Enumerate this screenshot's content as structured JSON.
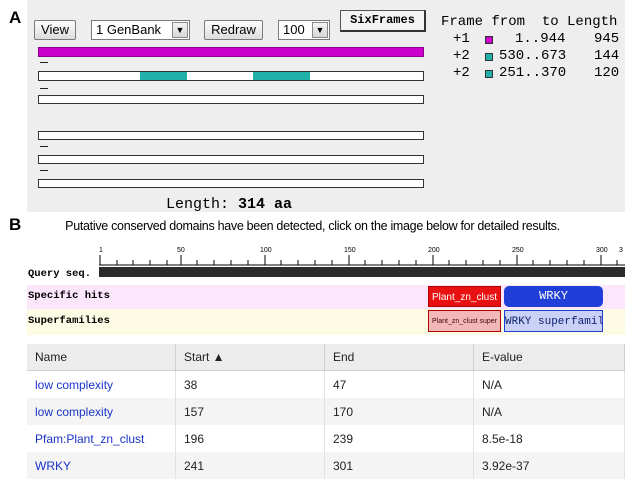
{
  "panel_labels": {
    "a": "A",
    "b": "B"
  },
  "toolbar": {
    "view_label": "View",
    "genbank_select": "1 GenBank",
    "redraw_label": "Redraw",
    "zoom_select": "100",
    "sixframes_label": "SixFrames"
  },
  "frame_table": {
    "header": "Frame from  to Length",
    "rows": [
      {
        "frame": "+1",
        "color": "#cc00cc",
        "range": "1..944",
        "length": "945"
      },
      {
        "frame": "+2",
        "color": "#20b2aa",
        "range": "530..673",
        "length": "144"
      },
      {
        "frame": "+2",
        "color": "#20b2aa",
        "range": "251..370",
        "length": "120"
      }
    ]
  },
  "length_line": {
    "prefix": "Length:",
    "value": "314 aa"
  },
  "cdd": {
    "notice": "Putative conserved domains have been detected, click on the image below for detailed results.",
    "row_labels": {
      "query": "Query seq.",
      "specific": "Specific hits",
      "super": "Superfamilies"
    },
    "ruler_ticks": [
      "1",
      "50",
      "100",
      "150",
      "200",
      "250",
      "300",
      "3"
    ],
    "specific_hits": [
      {
        "label": "Plant_zn_clust",
        "color": "#e81010"
      },
      {
        "label": "WRKY",
        "color": "#1f3fd8"
      }
    ],
    "superfamilies": [
      {
        "label": "Plant_zn_clust super",
        "color": "#f2b7b7"
      },
      {
        "label": "WRKY superfamily",
        "color": "#c9d1f6"
      }
    ]
  },
  "results_table": {
    "columns": [
      "Name",
      "Start ▲",
      "End",
      "E-value"
    ],
    "rows": [
      {
        "name": "low complexity",
        "start": "38",
        "end": "47",
        "evalue": "N/A"
      },
      {
        "name": "low complexity",
        "start": "157",
        "end": "170",
        "evalue": "N/A"
      },
      {
        "name": "Pfam:Plant_zn_clust",
        "start": "196",
        "end": "239",
        "evalue": "8.5e-18"
      },
      {
        "name": "WRKY",
        "start": "241",
        "end": "301",
        "evalue": "3.92e-37"
      }
    ]
  },
  "colors": {
    "frame1": "#cc00cc",
    "frame2": "#20b2aa",
    "specific_band": "#fbe6fb",
    "super_band": "#fdfbe3",
    "link": "#1a33c8"
  }
}
